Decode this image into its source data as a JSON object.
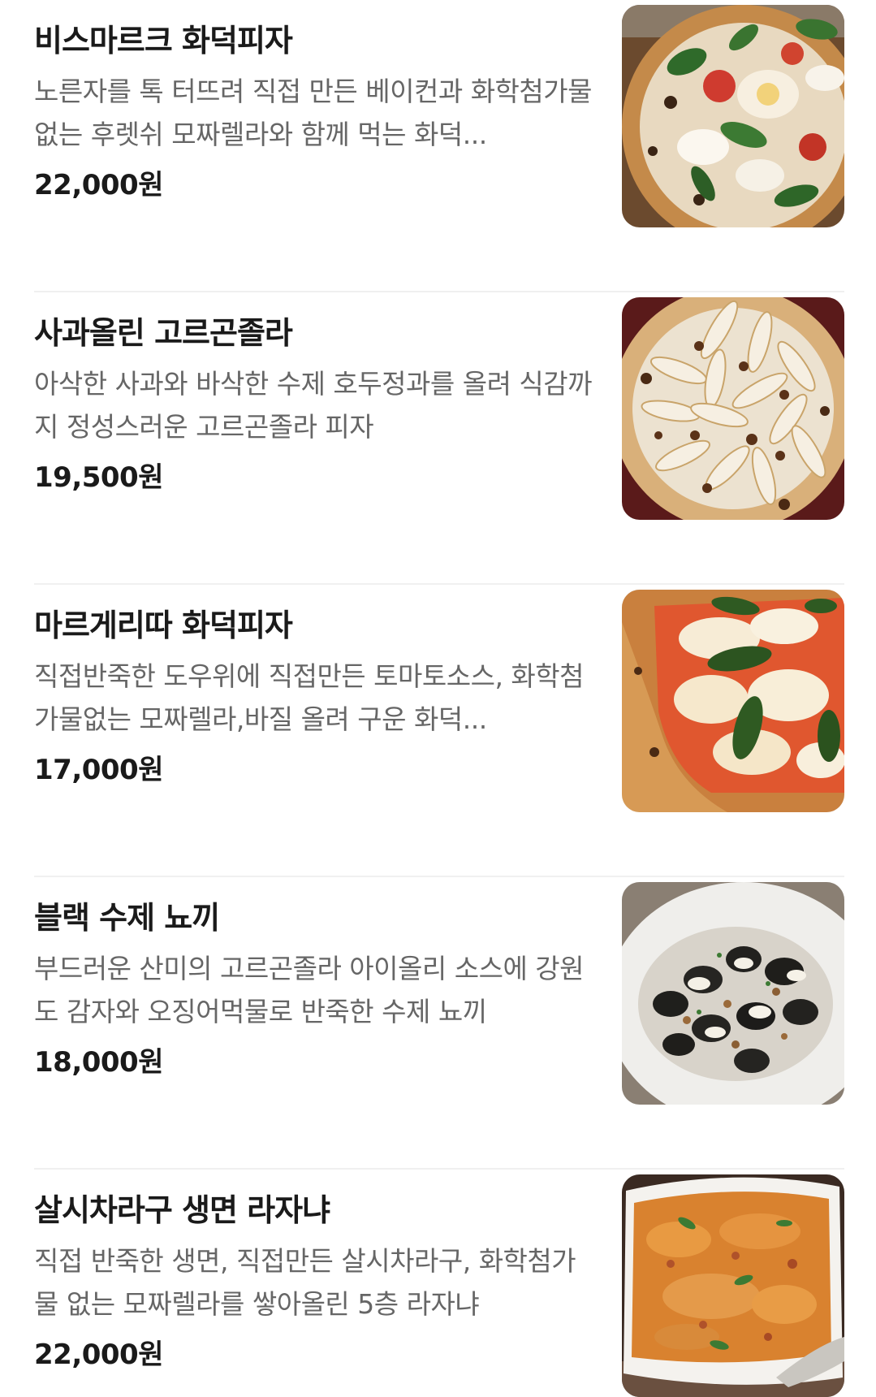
{
  "menu": {
    "items": [
      {
        "title": "비스마르크 화덕피자",
        "description": "노른자를 톡 터뜨려 직접 만든 베이컨과 화학첨가물없는 후렛쉬 모짜렐라와 함께 먹는 화덕...",
        "price": "22,000원",
        "image": "bismarck-pizza-photo"
      },
      {
        "title": "사과올린 고르곤졸라",
        "description": "아삭한 사과와 바삭한 수제 호두정과를 올려 식감까지 정성스러운 고르곤졸라 피자",
        "price": "19,500원",
        "image": "apple-gorgonzola-pizza-photo"
      },
      {
        "title": "마르게리따 화덕피자",
        "description": "직접반죽한 도우위에 직접만든 토마토소스, 화학첨가물없는 모짜렐라,바질 올려 구운 화덕...",
        "price": "17,000원",
        "image": "margherita-pizza-photo"
      },
      {
        "title": "블랙 수제 뇨끼",
        "description": "부드러운 산미의 고르곤졸라 아이올리 소스에 강원도 감자와 오징어먹물로 반죽한 수제 뇨끼",
        "price": "18,000원",
        "image": "black-gnocchi-photo"
      },
      {
        "title": "살시차라구 생면 라자냐",
        "description": "직접 반죽한 생면, 직접만든 살시차라구, 화학첨가물 없는 모짜렐라를 쌓아올린 5층 라자냐",
        "price": "22,000원",
        "image": "salsiccia-lasagna-photo"
      }
    ]
  }
}
